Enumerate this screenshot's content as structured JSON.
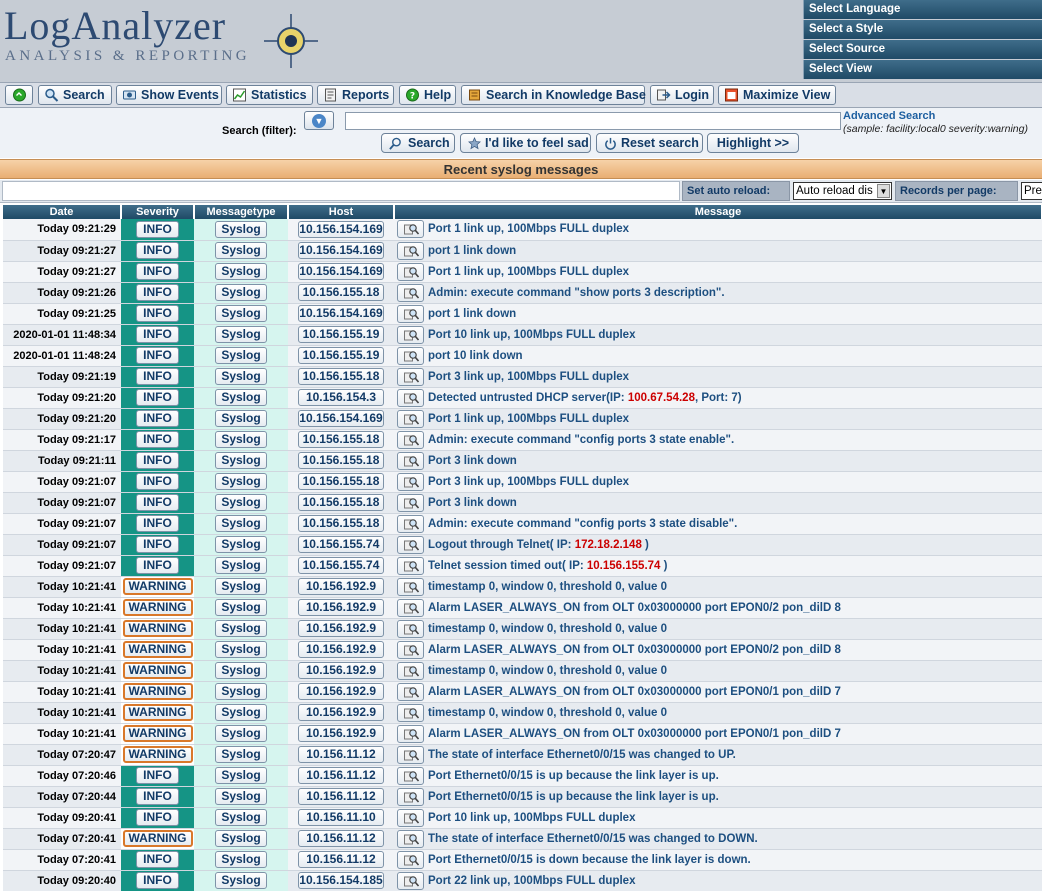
{
  "header": {
    "logo_main": "LogAnalyzer",
    "logo_sub": "ANALYSIS & REPORTING",
    "select_menu": [
      "Select Language",
      "Select a Style",
      "Select Source",
      "Select View"
    ]
  },
  "toolbar": {
    "buttons": [
      {
        "label": "",
        "icon": "green-circle-icon"
      },
      {
        "label": "Search",
        "icon": "magnifier-icon"
      },
      {
        "label": "Show Events",
        "icon": "events-icon"
      },
      {
        "label": "Statistics",
        "icon": "chart-icon"
      },
      {
        "label": "Reports",
        "icon": "reports-icon"
      },
      {
        "label": "Help",
        "icon": "help-icon"
      },
      {
        "label": "Search in Knowledge Base",
        "icon": "book-icon"
      },
      {
        "label": "Login",
        "icon": "login-icon"
      },
      {
        "label": "Maximize View",
        "icon": "maximize-icon"
      }
    ]
  },
  "search": {
    "label": "Search (filter):",
    "value": "",
    "advanced_link": "Advanced Search",
    "sample": "(sample: facility:local0 severity:warning)",
    "buttons": {
      "search": "Search",
      "sad": "I'd like to feel sad",
      "reset": "Reset search",
      "highlight": "Highlight >>"
    }
  },
  "section": {
    "title": "Recent syslog messages",
    "auto_reload_label": "Set auto reload:",
    "auto_reload_value": "Auto reload dis",
    "records_label": "Records per page:",
    "records_value": "Pre"
  },
  "table": {
    "headers": [
      "Date",
      "Severity",
      "Messagetype",
      "Host",
      "Message"
    ],
    "rows": [
      {
        "date": "Today 09:21:29",
        "severity": "INFO",
        "type": "Syslog",
        "host": "10.156.154.169",
        "message": "Port 1 link up, 100Mbps FULL duplex"
      },
      {
        "date": "Today 09:21:27",
        "severity": "INFO",
        "type": "Syslog",
        "host": "10.156.154.169",
        "message": "port 1 link down"
      },
      {
        "date": "Today 09:21:27",
        "severity": "INFO",
        "type": "Syslog",
        "host": "10.156.154.169",
        "message": "Port 1 link up, 100Mbps FULL duplex"
      },
      {
        "date": "Today 09:21:26",
        "severity": "INFO",
        "type": "Syslog",
        "host": "10.156.155.18",
        "message": "Admin: execute command \"show ports 3 description\"."
      },
      {
        "date": "Today 09:21:25",
        "severity": "INFO",
        "type": "Syslog",
        "host": "10.156.154.169",
        "message": "port 1 link down"
      },
      {
        "date": "2020-01-01 11:48:34",
        "severity": "INFO",
        "type": "Syslog",
        "host": "10.156.155.19",
        "message": "Port 10 link up, 100Mbps FULL duplex"
      },
      {
        "date": "2020-01-01 11:48:24",
        "severity": "INFO",
        "type": "Syslog",
        "host": "10.156.155.19",
        "message": "port 10 link down"
      },
      {
        "date": "Today 09:21:19",
        "severity": "INFO",
        "type": "Syslog",
        "host": "10.156.155.18",
        "message": "Port 3 link up, 100Mbps FULL duplex"
      },
      {
        "date": "Today 09:21:20",
        "severity": "INFO",
        "type": "Syslog",
        "host": "10.156.154.3",
        "message": "Detected untrusted DHCP server(IP: ",
        "hl": "100.67.54.28",
        "message_after": ", Port: 7)"
      },
      {
        "date": "Today 09:21:20",
        "severity": "INFO",
        "type": "Syslog",
        "host": "10.156.154.169",
        "message": "Port 1 link up, 100Mbps FULL duplex"
      },
      {
        "date": "Today 09:21:17",
        "severity": "INFO",
        "type": "Syslog",
        "host": "10.156.155.18",
        "message": "Admin: execute command \"config ports 3 state enable\"."
      },
      {
        "date": "Today 09:21:11",
        "severity": "INFO",
        "type": "Syslog",
        "host": "10.156.155.18",
        "message": "Port 3 link down"
      },
      {
        "date": "Today 09:21:07",
        "severity": "INFO",
        "type": "Syslog",
        "host": "10.156.155.18",
        "message": "Port 3 link up, 100Mbps FULL duplex"
      },
      {
        "date": "Today 09:21:07",
        "severity": "INFO",
        "type": "Syslog",
        "host": "10.156.155.18",
        "message": "Port 3 link down"
      },
      {
        "date": "Today 09:21:07",
        "severity": "INFO",
        "type": "Syslog",
        "host": "10.156.155.18",
        "message": "Admin: execute command \"config ports 3 state disable\"."
      },
      {
        "date": "Today 09:21:07",
        "severity": "INFO",
        "type": "Syslog",
        "host": "10.156.155.74",
        "message": "Logout through Telnet( IP: ",
        "hl": "172.18.2.148",
        "message_after": " )"
      },
      {
        "date": "Today 09:21:07",
        "severity": "INFO",
        "type": "Syslog",
        "host": "10.156.155.74",
        "message": "Telnet session timed out( IP: ",
        "hl": "10.156.155.74",
        "message_after": " )"
      },
      {
        "date": "Today 10:21:41",
        "severity": "WARNING",
        "type": "Syslog",
        "host": "10.156.192.9",
        "message": "timestamp 0, window 0, threshold 0, value 0"
      },
      {
        "date": "Today 10:21:41",
        "severity": "WARNING",
        "type": "Syslog",
        "host": "10.156.192.9",
        "message": "Alarm LASER_ALWAYS_ON from OLT 0x03000000 port EPON0/2 pon_dilD 8"
      },
      {
        "date": "Today 10:21:41",
        "severity": "WARNING",
        "type": "Syslog",
        "host": "10.156.192.9",
        "message": "timestamp 0, window 0, threshold 0, value 0"
      },
      {
        "date": "Today 10:21:41",
        "severity": "WARNING",
        "type": "Syslog",
        "host": "10.156.192.9",
        "message": "Alarm LASER_ALWAYS_ON from OLT 0x03000000 port EPON0/2 pon_dilD 8"
      },
      {
        "date": "Today 10:21:41",
        "severity": "WARNING",
        "type": "Syslog",
        "host": "10.156.192.9",
        "message": "timestamp 0, window 0, threshold 0, value 0"
      },
      {
        "date": "Today 10:21:41",
        "severity": "WARNING",
        "type": "Syslog",
        "host": "10.156.192.9",
        "message": "Alarm LASER_ALWAYS_ON from OLT 0x03000000 port EPON0/1 pon_dilD 7"
      },
      {
        "date": "Today 10:21:41",
        "severity": "WARNING",
        "type": "Syslog",
        "host": "10.156.192.9",
        "message": "timestamp 0, window 0, threshold 0, value 0"
      },
      {
        "date": "Today 10:21:41",
        "severity": "WARNING",
        "type": "Syslog",
        "host": "10.156.192.9",
        "message": "Alarm LASER_ALWAYS_ON from OLT 0x03000000 port EPON0/1 pon_dilD 7"
      },
      {
        "date": "Today 07:20:47",
        "severity": "WARNING",
        "type": "Syslog",
        "host": "10.156.11.12",
        "message": "The state of interface Ethernet0/0/15 was changed to UP."
      },
      {
        "date": "Today 07:20:46",
        "severity": "INFO",
        "type": "Syslog",
        "host": "10.156.11.12",
        "message": "Port Ethernet0/0/15 is up because the link layer is up."
      },
      {
        "date": "Today 07:20:44",
        "severity": "INFO",
        "type": "Syslog",
        "host": "10.156.11.12",
        "message": "Port Ethernet0/0/15 is up because the link layer is up."
      },
      {
        "date": "Today 09:20:41",
        "severity": "INFO",
        "type": "Syslog",
        "host": "10.156.11.10",
        "message": "Port 10 link up, 100Mbps FULL duplex"
      },
      {
        "date": "Today 07:20:41",
        "severity": "WARNING",
        "type": "Syslog",
        "host": "10.156.11.12",
        "message": "The state of interface Ethernet0/0/15 was changed to DOWN."
      },
      {
        "date": "Today 07:20:41",
        "severity": "INFO",
        "type": "Syslog",
        "host": "10.156.11.12",
        "message": "Port Ethernet0/0/15 is down because the link layer is down."
      },
      {
        "date": "Today 09:20:40",
        "severity": "INFO",
        "type": "Syslog",
        "host": "10.156.154.185",
        "message": "Port 22 link up, 100Mbps FULL duplex"
      }
    ]
  },
  "colors": {
    "info_bg": "#159485",
    "warning_border": "#d9782a",
    "header_bar": "#1f4a66",
    "link_text": "#1d4f80",
    "highlight": "#cc0000"
  }
}
